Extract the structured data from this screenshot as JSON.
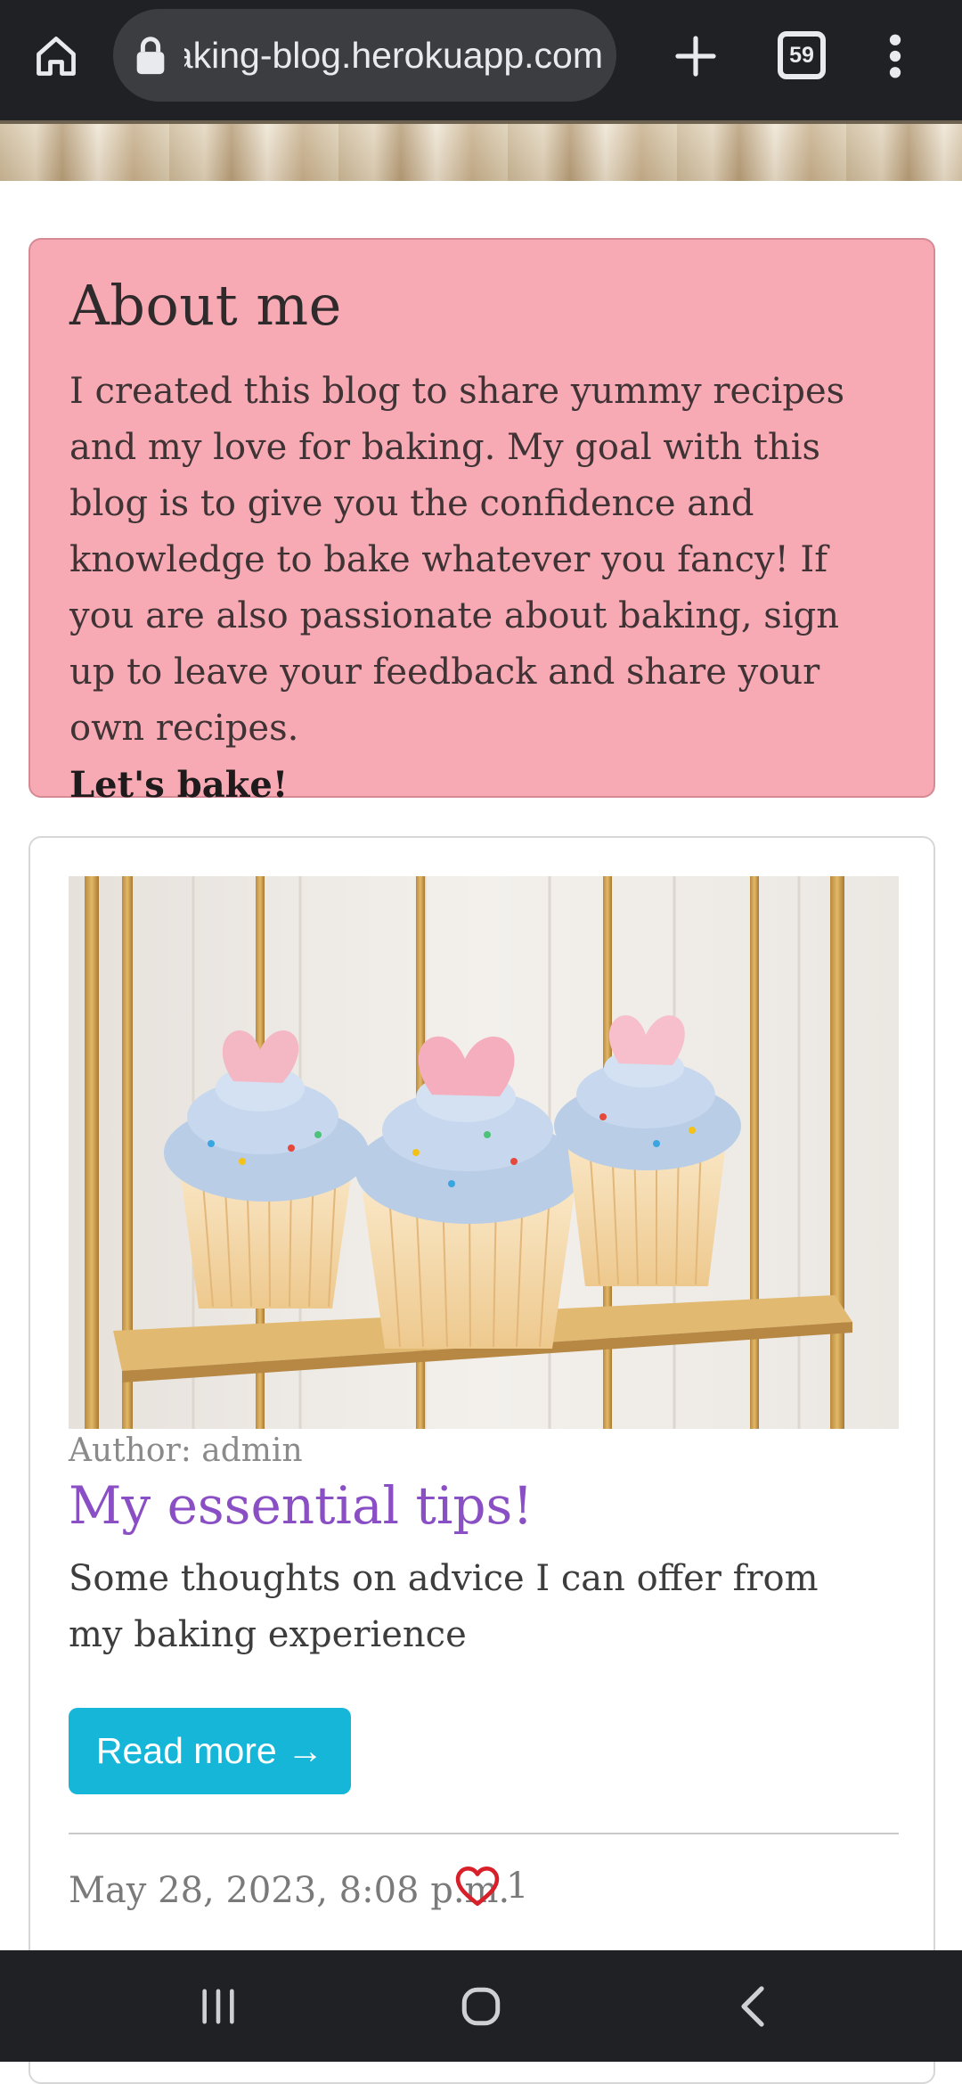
{
  "browser": {
    "url": "baking-blog.herokuapp.com",
    "tab_count": "59",
    "icons": [
      "home-icon",
      "lock-icon",
      "plus-icon",
      "tabs-icon",
      "more-vert-icon"
    ]
  },
  "about": {
    "title": "About me",
    "text": "I created this blog to share yummy recipes and my love for baking. My goal with this blog is to give you the confidence and knowledge to bake whatever you fancy! If you are also passionate about baking, sign up to leave your feedback and share your own recipes.",
    "cta": "Let's bake!",
    "bg_color": "#f7aab4"
  },
  "post": {
    "author": "Author: admin",
    "title": "My essential tips!",
    "excerpt": "Some thoughts on advice I can offer from my baking experience",
    "read_more_label": "Read more →",
    "date": "May 28, 2023, 8:08 p.m.",
    "likes": "1",
    "title_color": "#8a4fc4",
    "button_color": "#15b6d8",
    "heart_color": "#d8202a"
  },
  "nav": {
    "icons": [
      "recents-icon",
      "home-circle-icon",
      "back-icon"
    ]
  }
}
